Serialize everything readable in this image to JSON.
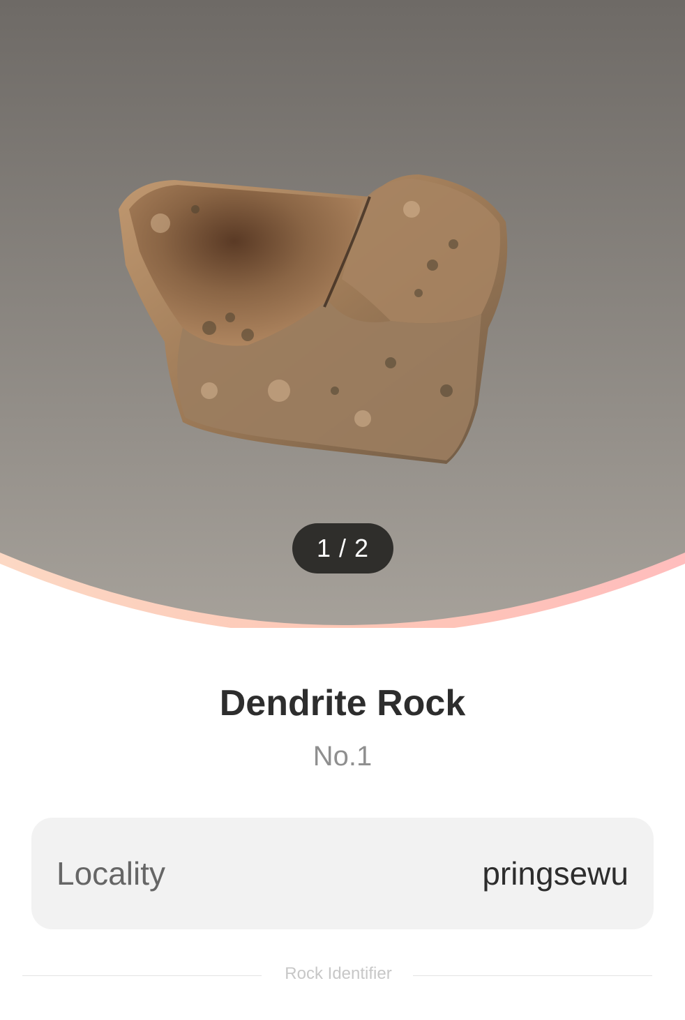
{
  "gallery": {
    "pager_text": "1 / 2"
  },
  "specimen": {
    "name": "Dendrite Rock",
    "number": "No.1"
  },
  "details": {
    "locality_label": "Locality",
    "locality_value": "pringsewu"
  },
  "footer": {
    "brand": "Rock Identifier"
  },
  "colors": {
    "hero_top": "#6e6a66",
    "hero_bottom": "#a49f98",
    "arc_left": "#fcd3bd",
    "arc_right": "#ffbdbd",
    "pager_bg": "#2f2e2b",
    "card_bg": "#f2f2f2"
  }
}
